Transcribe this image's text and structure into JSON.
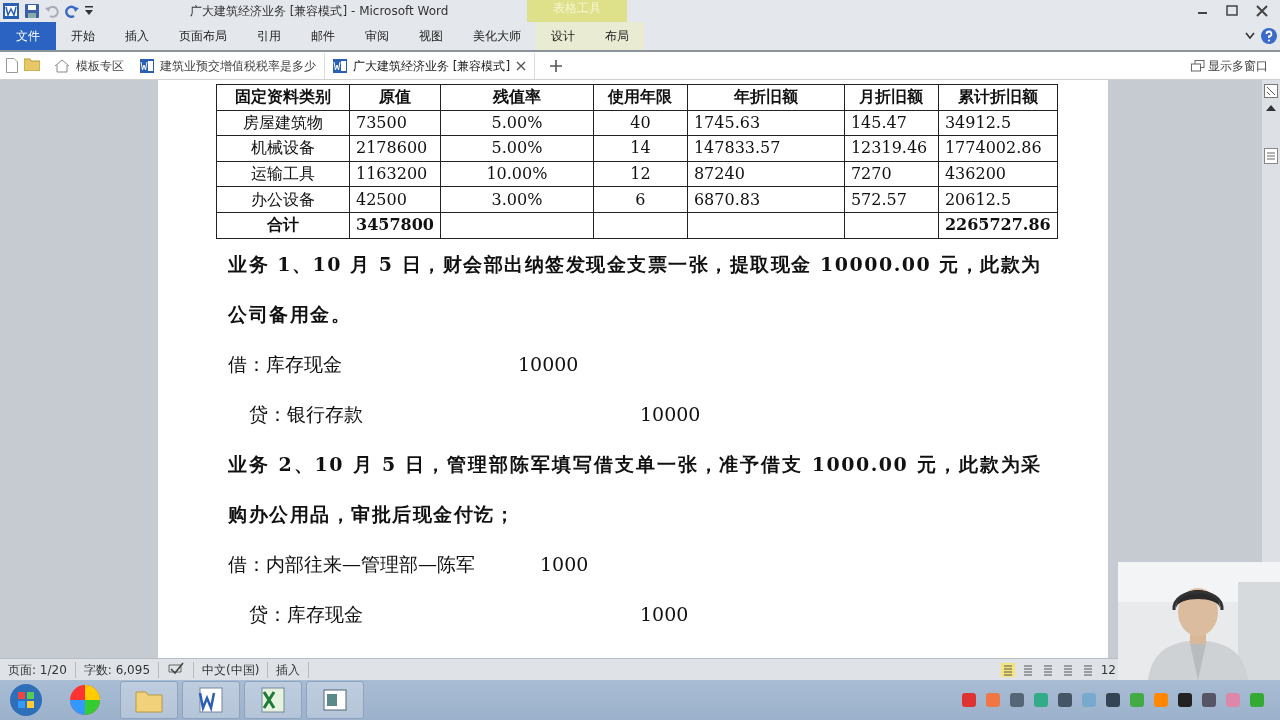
{
  "window": {
    "title": "广大建筑经济业务 [兼容模式] - Microsoft Word",
    "contextual_group": "表格工具"
  },
  "ribbon_tabs": [
    {
      "label": "文件",
      "kind": "file"
    },
    {
      "label": "开始",
      "kind": "tab"
    },
    {
      "label": "插入",
      "kind": "tab"
    },
    {
      "label": "页面布局",
      "kind": "tab"
    },
    {
      "label": "引用",
      "kind": "tab"
    },
    {
      "label": "邮件",
      "kind": "tab"
    },
    {
      "label": "审阅",
      "kind": "tab"
    },
    {
      "label": "视图",
      "kind": "tab"
    },
    {
      "label": "美化大师",
      "kind": "tab"
    },
    {
      "label": "设计",
      "kind": "contextual"
    },
    {
      "label": "布局",
      "kind": "contextual"
    }
  ],
  "doc_tabs": [
    {
      "label": "模板专区",
      "kind": "home",
      "selected": false
    },
    {
      "label": "建筑业预交增值税税率是多少",
      "kind": "document",
      "selected": false
    },
    {
      "label": "广大建筑经济业务 [兼容模式]",
      "kind": "document",
      "selected": true
    }
  ],
  "multi_window": "显示多窗口",
  "table": {
    "columns": [
      "固定资料类别",
      "原值",
      "残值率",
      "使用年限",
      "年折旧额",
      "月折旧额",
      "累计折旧额"
    ],
    "rows": [
      {
        "kind": "item",
        "cells": [
          "房屋建筑物",
          "73500",
          "5.00%",
          "40",
          "1745.63",
          "145.47",
          "34912.5"
        ]
      },
      {
        "kind": "item",
        "cells": [
          "机械设备",
          "2178600",
          "5.00%",
          "14",
          "147833.57",
          "12319.46",
          "1774002.86"
        ]
      },
      {
        "kind": "item",
        "cells": [
          "运输工具",
          "1163200",
          "10.00%",
          "12",
          "87240",
          "7270",
          "436200"
        ]
      },
      {
        "kind": "item",
        "cells": [
          "办公设备",
          "42500",
          "3.00%",
          "6",
          "6870.83",
          "572.57",
          "20612.5"
        ]
      },
      {
        "kind": "total",
        "cells": [
          "合计",
          "3457800",
          "",
          "",
          "",
          "",
          "2265727.86"
        ]
      }
    ]
  },
  "entries": [
    {
      "kind": "heading",
      "text": "业务 1、10 月 5 日，财会部出纳签发现金支票一张，提取现金 10000.00 元，此款为公司备用金。"
    },
    {
      "kind": "debit",
      "label": "借：库存现金",
      "amount": "10000"
    },
    {
      "kind": "credit",
      "label": "贷：银行存款",
      "amount": "10000"
    },
    {
      "kind": "heading",
      "text": "业务 2、10 月 5 日，管理部陈军填写借支单一张，准予借支 1000.00 元，此款为采购办公用品，审批后现金付讫；"
    },
    {
      "kind": "debit",
      "label": "借：内部往来—管理部—陈军",
      "amount": "1000"
    },
    {
      "kind": "credit",
      "label": "贷：库存现金",
      "amount": "1000"
    }
  ],
  "status_bar": {
    "page": "页面: 1/20",
    "words": "字数: 6,095",
    "language": "中文(中国)",
    "mode": "插入",
    "zoom": "12"
  }
}
